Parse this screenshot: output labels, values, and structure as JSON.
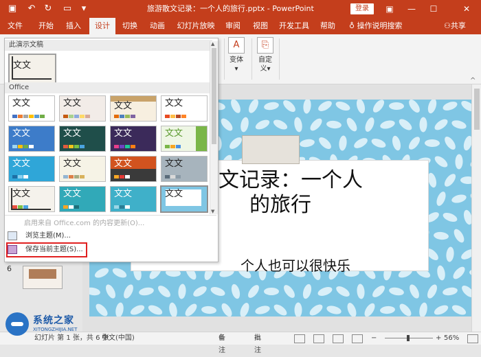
{
  "titlebar": {
    "title": "旅游散文记录：一个人的旅行.pptx - PowerPoint",
    "login": "登录",
    "save_icon": "save-icon",
    "undo_icon": "undo-icon",
    "redo_icon": "redo-icon",
    "present_icon": "present-from-start-icon",
    "colors": {
      "accent": "#c43e1c"
    }
  },
  "tabs": [
    {
      "label": "文件"
    },
    {
      "label": "开始"
    },
    {
      "label": "插入"
    },
    {
      "label": "设计"
    },
    {
      "label": "切换"
    },
    {
      "label": "动画"
    },
    {
      "label": "幻灯片放映"
    },
    {
      "label": "审阅"
    },
    {
      "label": "视图"
    },
    {
      "label": "开发工具"
    },
    {
      "label": "帮助"
    }
  ],
  "tellme": "操作说明搜索",
  "share": "共享",
  "ribbon": {
    "variants": {
      "label": "变体"
    },
    "customize": {
      "label": "自定",
      "label2": "义"
    }
  },
  "dropdown": {
    "section_this": "此演示文稿",
    "section_office": "Office",
    "theme_text": "文文",
    "menu": {
      "update": "启用来自 Office.com 的内容更新(O)...",
      "browse": "浏览主题(M)...",
      "save": "保存当前主题(S)..."
    }
  },
  "slide": {
    "title_line1": "文文记录：一个人",
    "title_line2": "的旅行",
    "subtitle": "个人也可以很快乐",
    "thumb_number": "6"
  },
  "status": {
    "slide_info": "幻灯片 第 1 张，共 6 张",
    "language": "中文(中国)",
    "notes": "备注",
    "comments": "批注",
    "zoom": "56%"
  },
  "watermark": {
    "name": "系统之家",
    "url": "XITONGZHIJIA.NET"
  }
}
